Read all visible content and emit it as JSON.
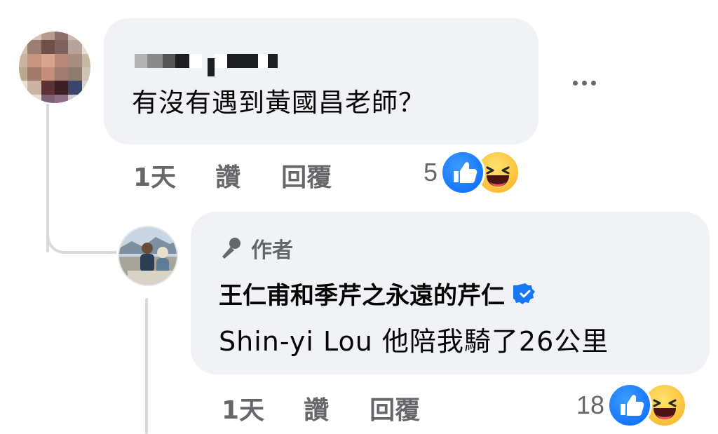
{
  "comments": [
    {
      "author_redacted": true,
      "text": "有沒有遇到黃國昌老師？",
      "time": "1天",
      "like_label": "讚",
      "reply_label": "回覆",
      "reaction_count": "5"
    }
  ],
  "reply": {
    "badge": "作者",
    "author": "王仁甫和季芹之永遠的芹仁",
    "verified": true,
    "text": "Shin-yi Lou 他陪我騎了26公里",
    "time": "1天",
    "like_label": "讚",
    "reply_label": "回覆",
    "reaction_count": "18"
  },
  "colors": {
    "bubble": "#f0f2f5",
    "secondary_text": "#65676b",
    "like_blue": "#0866ff",
    "verified_blue": "#1877f2",
    "haha_yellow": "#f7b125"
  },
  "icons": [
    "more-icon",
    "like-reaction-icon",
    "haha-reaction-icon",
    "microphone-icon",
    "verified-badge-icon"
  ]
}
